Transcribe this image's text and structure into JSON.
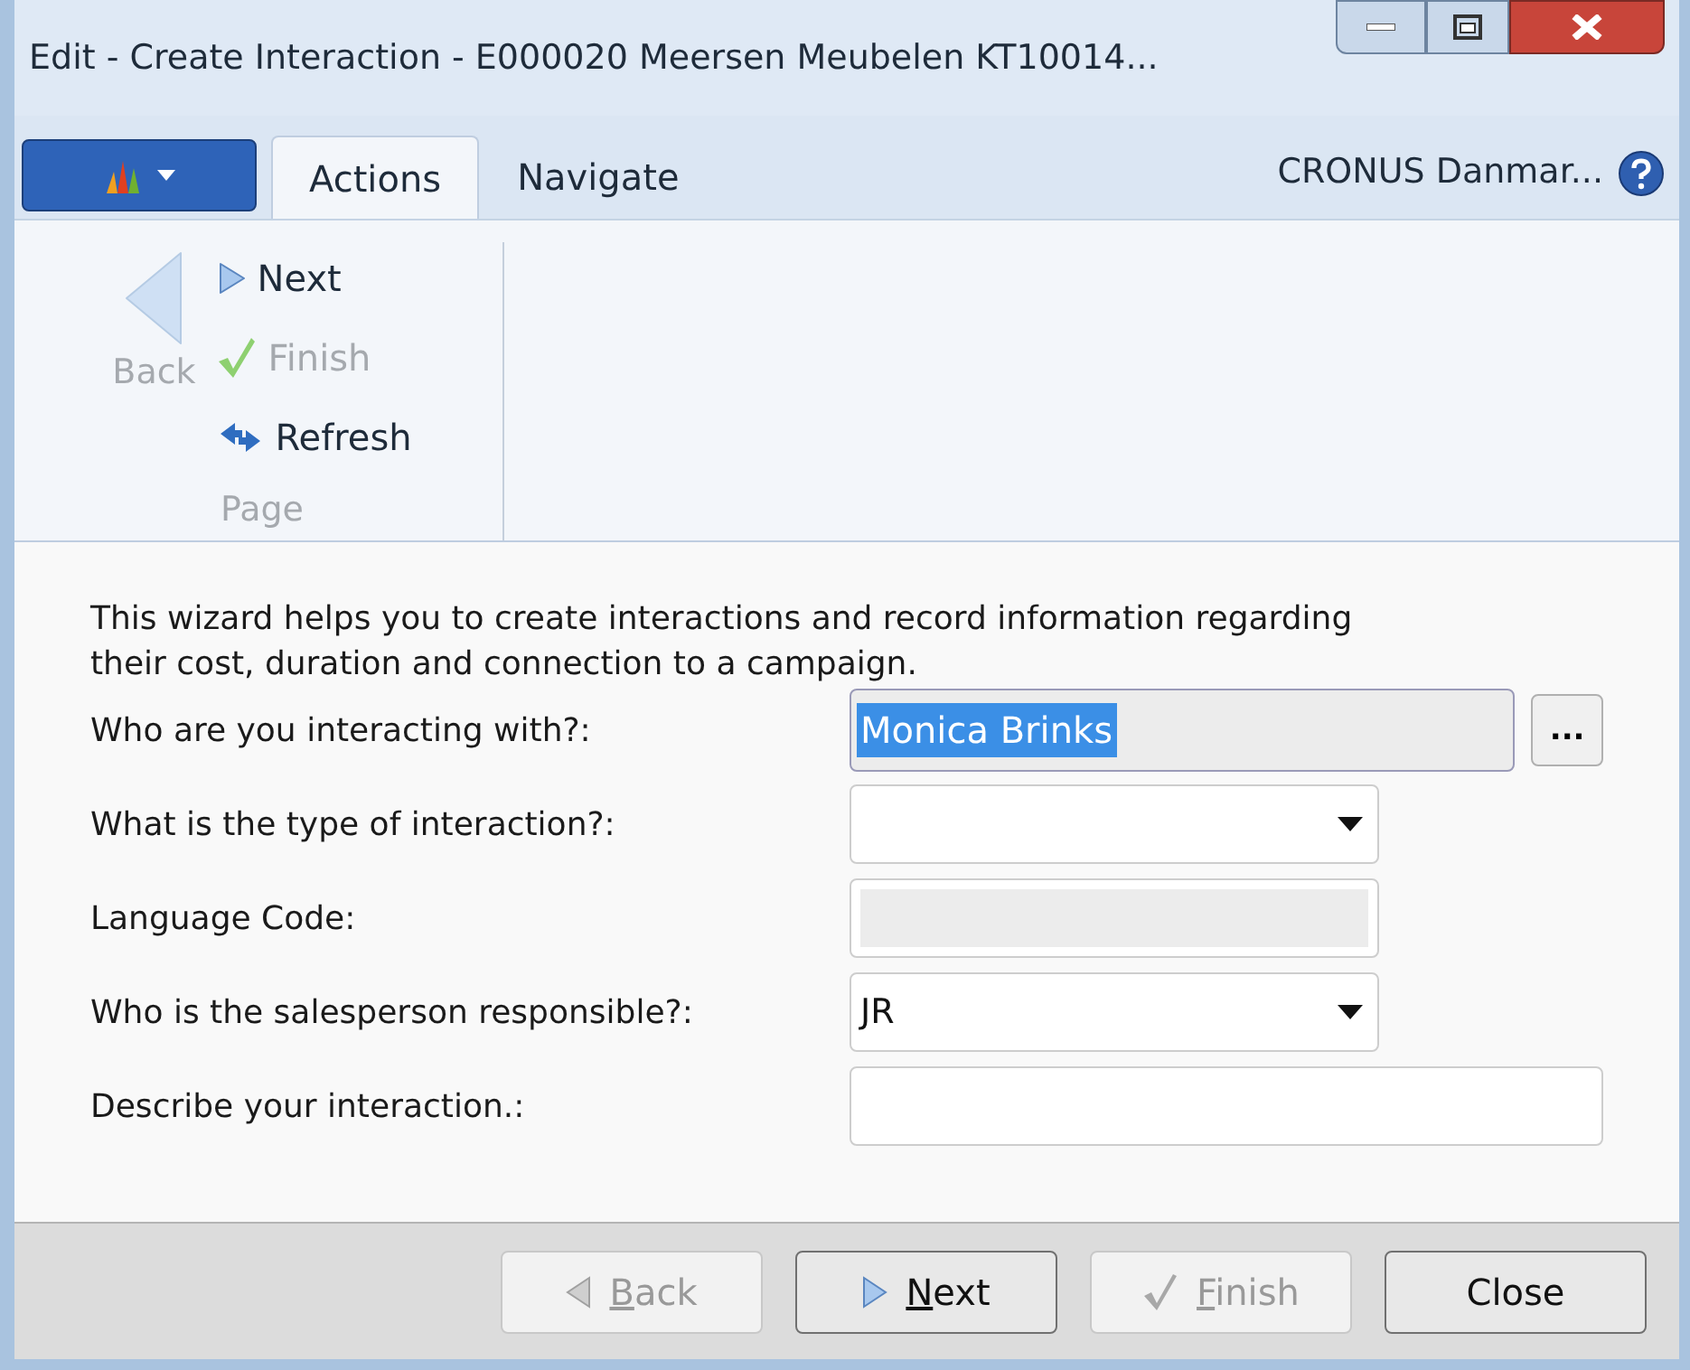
{
  "window": {
    "title": "Edit - Create Interaction - E000020 Meersen Meubelen KT10014..."
  },
  "tabs": [
    {
      "label": "Actions",
      "selected": true
    },
    {
      "label": "Navigate",
      "selected": false
    }
  ],
  "company": "CRONUS Danmar...",
  "ribbon": {
    "group": "Page",
    "back": {
      "label": "Back",
      "disabled": true
    },
    "actions": [
      {
        "kind": "next",
        "label": "Next",
        "disabled": false
      },
      {
        "kind": "finish",
        "label": "Finish",
        "disabled": true
      },
      {
        "kind": "refresh",
        "label": "Refresh",
        "disabled": false
      }
    ]
  },
  "intro": "This wizard helps you to create interactions and record information regarding their cost, duration and connection to a campaign.",
  "fields": [
    {
      "label": "Who are you interacting with?:",
      "kind": "lookup",
      "value": "Monica Brinks",
      "highlighted": true,
      "button": "..."
    },
    {
      "label": "What is the type of interaction?:",
      "kind": "dropdown"
    },
    {
      "label": "Language Code:",
      "kind": "readonly"
    },
    {
      "label": "Who is the salesperson responsible?:",
      "kind": "dropdown",
      "value": "JR"
    },
    {
      "label": "Describe your interaction.:",
      "kind": "text"
    }
  ],
  "buttons": [
    {
      "kind": "back",
      "label": "Back",
      "mnemonic": true,
      "disabled": true
    },
    {
      "kind": "next",
      "label": "Next",
      "mnemonic": true,
      "disabled": false
    },
    {
      "kind": "finish",
      "label": "Finish",
      "mnemonic": true,
      "disabled": true
    },
    {
      "kind": "close",
      "label": "Close",
      "mnemonic": false,
      "disabled": false
    }
  ]
}
